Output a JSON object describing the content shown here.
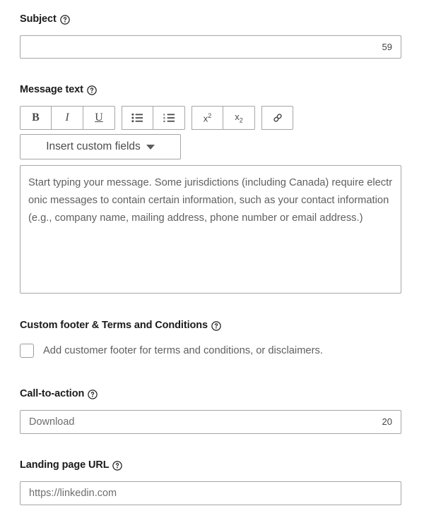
{
  "theme": {
    "page_background": "#ffffff",
    "label_color": "#1b1b1b",
    "placeholder_color": "#5f5f5f",
    "border_color": "#a6a6a6",
    "icon_color": "#4a4a4a"
  },
  "subject": {
    "label": "Subject",
    "help_icon": "help-circle-icon",
    "value": "",
    "placeholder": "",
    "counter": "59"
  },
  "message": {
    "label": "Message text",
    "help_icon": "help-circle-icon",
    "toolbar": {
      "groups": [
        {
          "name": "text-style",
          "buttons": [
            {
              "name": "bold-button",
              "icon": "bold-icon",
              "label": "B"
            },
            {
              "name": "italic-button",
              "icon": "italic-icon",
              "label": "I"
            },
            {
              "name": "underline-button",
              "icon": "underline-icon",
              "label": "U"
            }
          ]
        },
        {
          "name": "lists",
          "buttons": [
            {
              "name": "bulleted-list-button",
              "icon": "bulleted-list-icon",
              "label": ""
            },
            {
              "name": "numbered-list-button",
              "icon": "numbered-list-icon",
              "label": ""
            }
          ]
        },
        {
          "name": "script",
          "buttons": [
            {
              "name": "superscript-button",
              "icon": "superscript-icon",
              "label": "x2"
            },
            {
              "name": "subscript-button",
              "icon": "subscript-icon",
              "label": "x2"
            }
          ]
        },
        {
          "name": "link",
          "buttons": [
            {
              "name": "insert-link-button",
              "icon": "link-icon",
              "label": ""
            }
          ]
        }
      ]
    },
    "insert_custom_fields": {
      "label": "Insert custom fields",
      "icon": "chevron-down-icon"
    },
    "placeholder": "Start typing your message. Some jurisdictions (including Canada) require electronic messages to contain certain information, such as your contact information (e.g., company name, mailing address, phone number or email address.)",
    "value": ""
  },
  "custom_footer": {
    "label": "Custom footer & Terms and Conditions",
    "help_icon": "help-circle-icon",
    "checkbox": {
      "label": "Add customer footer for terms and conditions, or disclaimers.",
      "checked": false
    }
  },
  "call_to_action": {
    "label": "Call-to-action",
    "help_icon": "help-circle-icon",
    "value": "",
    "placeholder": "Download",
    "counter": "20"
  },
  "landing_page_url": {
    "label": "Landing page URL",
    "help_icon": "help-circle-icon",
    "value": "",
    "placeholder": "https://linkedin.com"
  }
}
